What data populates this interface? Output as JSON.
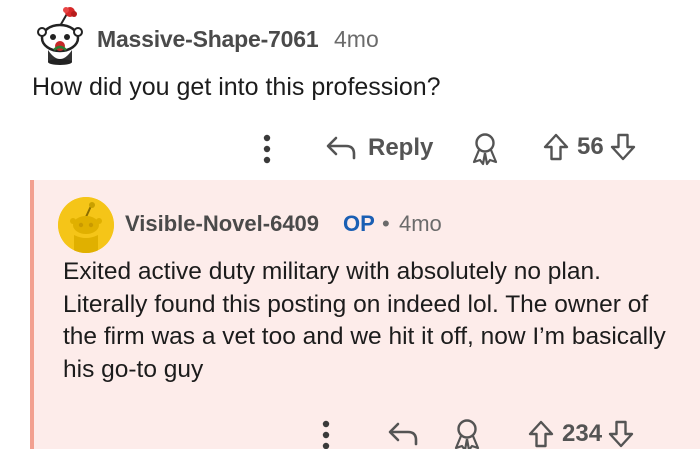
{
  "parent_comment": {
    "username": "Massive-Shape-7061",
    "age": "4mo",
    "text": "How did you get into this profession?",
    "actions": {
      "more_icon": "more-vertical-icon",
      "reply_label": "Reply",
      "award_icon": "award-icon",
      "vote_count": "56"
    }
  },
  "reply_comment": {
    "username": "Visible-Novel-6409",
    "op_badge": "OP",
    "separator": "•",
    "age": "4mo",
    "text": "Exited active duty military with absolutely no plan. Literally found this posting on indeed lol. The owner of the firm was a vet too and we hit it off, now I’m basically his go-to guy",
    "actions": {
      "more_icon": "more-vertical-icon",
      "reply_icon": "reply-arrow-icon",
      "award_icon": "award-icon",
      "vote_count": "234"
    }
  },
  "colors": {
    "thread_background": "#fdecea",
    "thread_border": "#f2a090",
    "op_badge": "#1a5fb4",
    "avatar_yellow": "#f5c518"
  }
}
